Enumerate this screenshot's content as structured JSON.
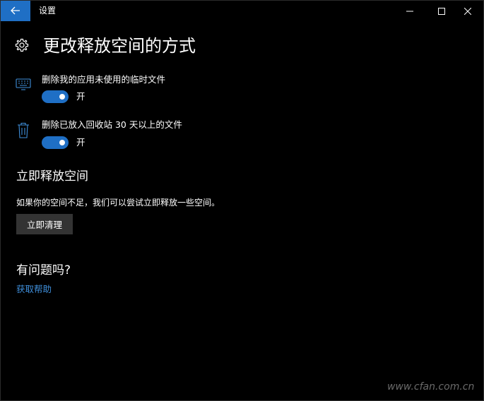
{
  "window": {
    "title": "设置",
    "back_icon": "arrow-left-icon",
    "controls": [
      "minimize-icon",
      "maximize-icon",
      "close-icon"
    ]
  },
  "header": {
    "icon": "gear-icon",
    "title": "更改释放空间的方式"
  },
  "settings": [
    {
      "icon": "keyboard-icon",
      "label": "删除我的应用未使用的临时文件",
      "toggle_on": true,
      "state_label": "开"
    },
    {
      "icon": "trash-icon",
      "label": "删除已放入回收站 30 天以上的文件",
      "toggle_on": true,
      "state_label": "开"
    }
  ],
  "free_now": {
    "heading": "立即释放空间",
    "description": "如果你的空间不足，我们可以尝试立即释放一些空间。",
    "button_label": "立即清理"
  },
  "help": {
    "heading": "有问题吗?",
    "link_label": "获取帮助"
  },
  "watermark": "www.cfan.com.cn",
  "colors": {
    "accent": "#1f6fc5",
    "link": "#3f8fdb",
    "background": "#000000",
    "button": "#333333"
  }
}
